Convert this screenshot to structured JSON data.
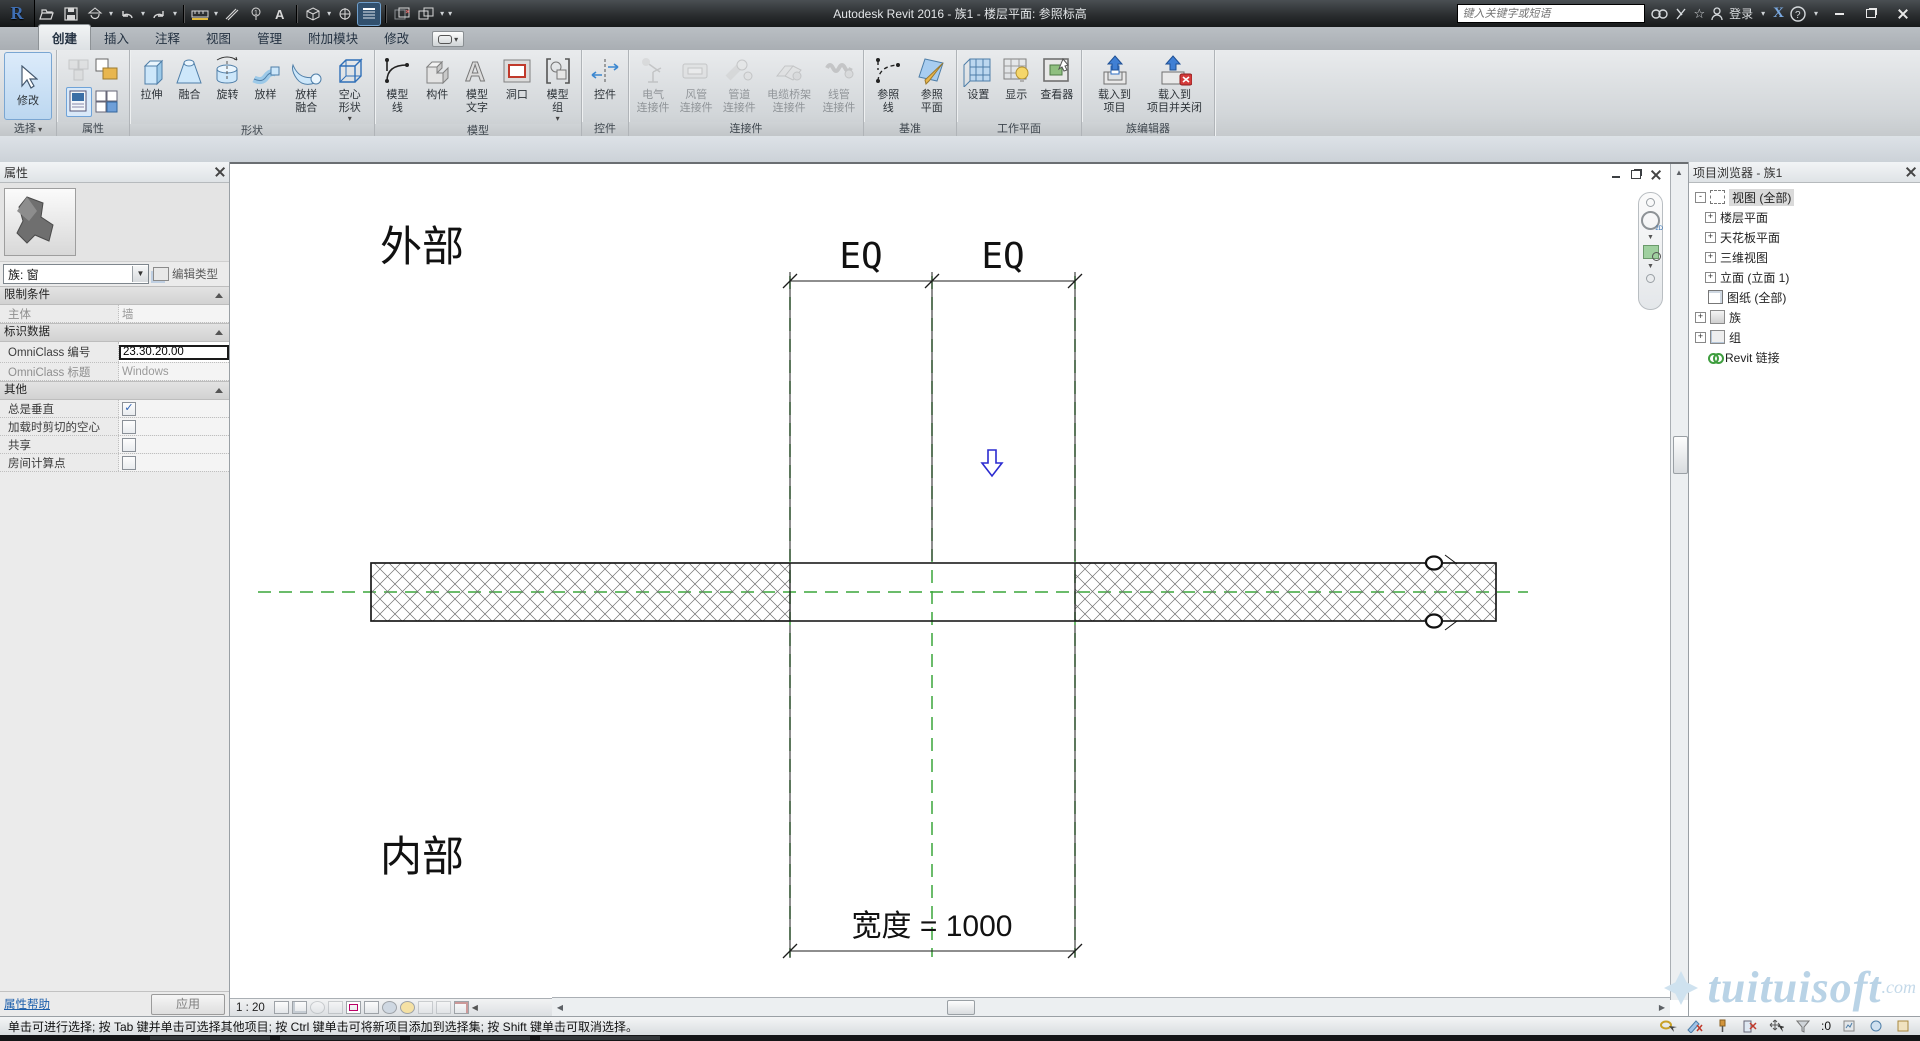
{
  "title_bar": {
    "title": "Autodesk Revit 2016 -   族1 - 楼层平面: 参照标高",
    "search_placeholder": "键入关键字或短语",
    "signin_label": "登录",
    "qat_icons": [
      "app-menu",
      "open",
      "save",
      "sync-with-central",
      "undo",
      "redo",
      "measure",
      "aligned-dimension",
      "tag-by-category",
      "text",
      "default-3d-view",
      "section",
      "thin-lines",
      "close-hidden-windows",
      "switch-windows",
      "customize-quick-access"
    ]
  },
  "ribbon": {
    "active_tab": "创建",
    "tabs": [
      "创建",
      "插入",
      "注释",
      "视图",
      "管理",
      "附加模块",
      "修改"
    ],
    "panels": [
      {
        "label": "选择",
        "buttons": [
          "修改"
        ]
      },
      {
        "label": "属性",
        "buttons": []
      },
      {
        "label": "形状",
        "buttons": [
          "拉伸",
          "融合",
          "旋转",
          "放样",
          "放样\n融合",
          "空心\n形状"
        ]
      },
      {
        "label": "模型",
        "buttons": [
          "模型\n线",
          "构件",
          "模型\n文字",
          "洞口",
          "模型\n组"
        ]
      },
      {
        "label": "控件",
        "buttons": [
          "控件"
        ]
      },
      {
        "label": "连接件",
        "buttons": [
          "电气\n连接件",
          "风管\n连接件",
          "管道\n连接件",
          "电缆桥架\n连接件",
          "线管\n连接件"
        ]
      },
      {
        "label": "基准",
        "buttons": [
          "参照\n线",
          "参照\n平面"
        ]
      },
      {
        "label": "工作平面",
        "buttons": [
          "设置",
          "显示",
          "查看器"
        ]
      },
      {
        "label": "族编辑器",
        "buttons": [
          "载入到\n项目",
          "载入到\n项目并关闭"
        ]
      }
    ]
  },
  "properties": {
    "title": "属性",
    "type_selector": "族: 窗",
    "edit_type_label": "编辑类型",
    "groups": [
      {
        "header": "限制条件",
        "rows": [
          {
            "label": "主体",
            "value": "墙"
          }
        ]
      },
      {
        "header": "标识数据",
        "rows": [
          {
            "label": "OmniClass 编号",
            "value": "23.30.20.00"
          },
          {
            "label": "OmniClass 标题",
            "value": "Windows"
          }
        ]
      },
      {
        "header": "其他",
        "rows": [
          {
            "label": "总是垂直",
            "check": "✓"
          },
          {
            "label": "加载时剪切的空心",
            "check": ""
          },
          {
            "label": "共享",
            "check": ""
          },
          {
            "label": "房间计算点",
            "check": ""
          }
        ]
      }
    ],
    "help_label": "属性帮助",
    "apply_label": "应用"
  },
  "browser": {
    "title": "项目浏览器 - 族1",
    "items": [
      "视图 (全部)",
      "楼层平面",
      "天花板平面",
      "三维视图",
      "立面 (立面 1)",
      "图纸 (全部)",
      "族",
      "组",
      "Revit 链接"
    ]
  },
  "canvas": {
    "exterior_label": "外部",
    "interior_label": "内部",
    "eq_label": "EQ",
    "width_label": "宽度 = 1000",
    "scale": "1 : 20",
    "colors": {
      "reference_plane_green": "#3aa63a",
      "selection_blue": "#bcd7f0"
    }
  },
  "status_bar": {
    "message": "单击可进行选择; 按 Tab 键并单击可选择其他项目; 按 Ctrl 键单击可将新项目添加到选择集; 按 Shift 键单击可取消选择。",
    "filter_count": ":0"
  },
  "watermark": {
    "text": "tuituisoft",
    "suffix": ".com"
  }
}
